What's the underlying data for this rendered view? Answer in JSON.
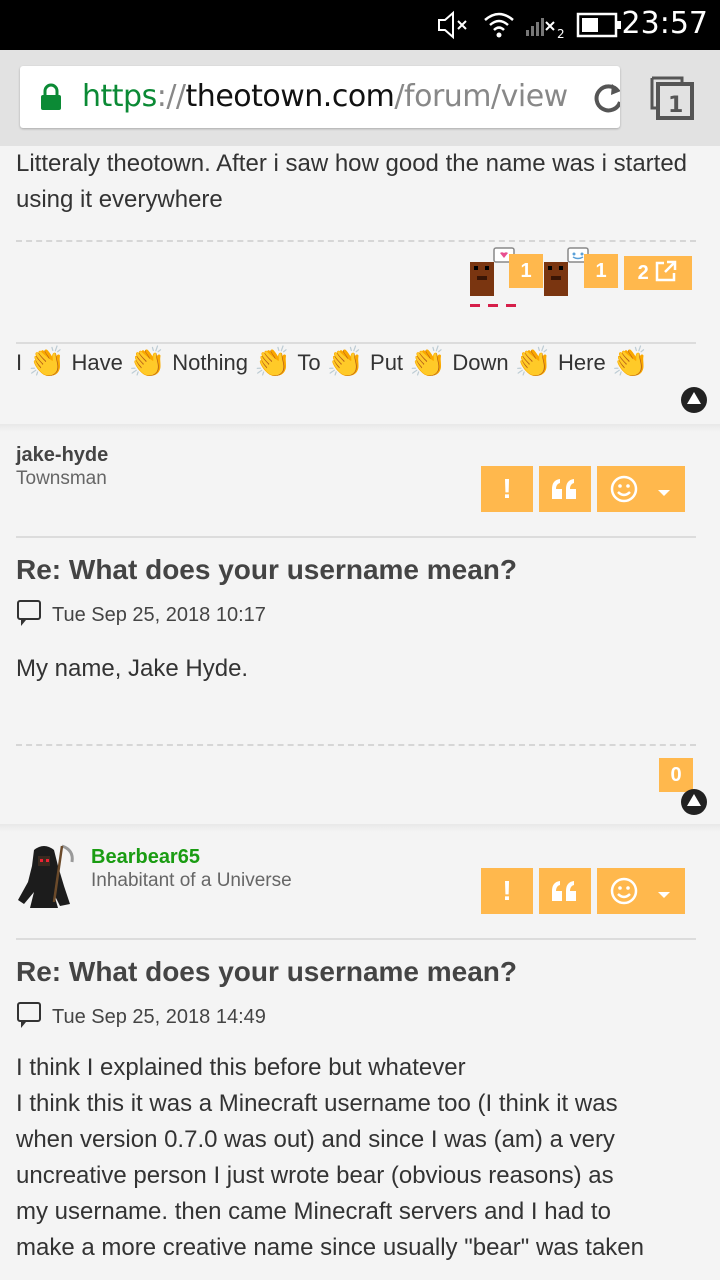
{
  "status_bar": {
    "time": "23:57"
  },
  "browser": {
    "url_scheme": "https",
    "url_sep": "://",
    "url_host": "theotown.com",
    "url_path": "/forum/viewtopic.php",
    "tab_count": "1"
  },
  "post0": {
    "body": "Litteraly theotown. After i saw how good the name was i started using it everywhere",
    "reactions": [
      {
        "count": "1"
      },
      {
        "count": "1"
      }
    ],
    "share_count": "2",
    "signature": [
      "I",
      "Have",
      "Nothing",
      "To",
      "Put",
      "Down",
      "Here"
    ]
  },
  "post1": {
    "username": "jake-hyde",
    "rank": "Townsman",
    "title": "Re: What does your username mean?",
    "date": "Tue Sep 25, 2018 10:17",
    "body": "My name, Jake Hyde.",
    "like_count": "0"
  },
  "post2": {
    "username": "Bearbear65",
    "rank": "Inhabitant of a Universe",
    "title": "Re: What does your username mean?",
    "date": "Tue Sep 25, 2018 14:49",
    "body_lines": [
      "I think I explained this before but whatever",
      "I think this it was a Minecraft username too (I think it was",
      "when version 0.7.0 was out) and since I was (am) a very",
      "uncreative person I just wrote bear (obvious reasons) as",
      "my username. then came Minecraft servers and I had to",
      "make a more creative name since usually \"bear\" was taken"
    ]
  },
  "buttons": {
    "report": "!",
    "quote": "66"
  },
  "colors": {
    "accent": "#ffb84d",
    "username_green": "#1a9c12",
    "url_green": "#0b8a35"
  }
}
